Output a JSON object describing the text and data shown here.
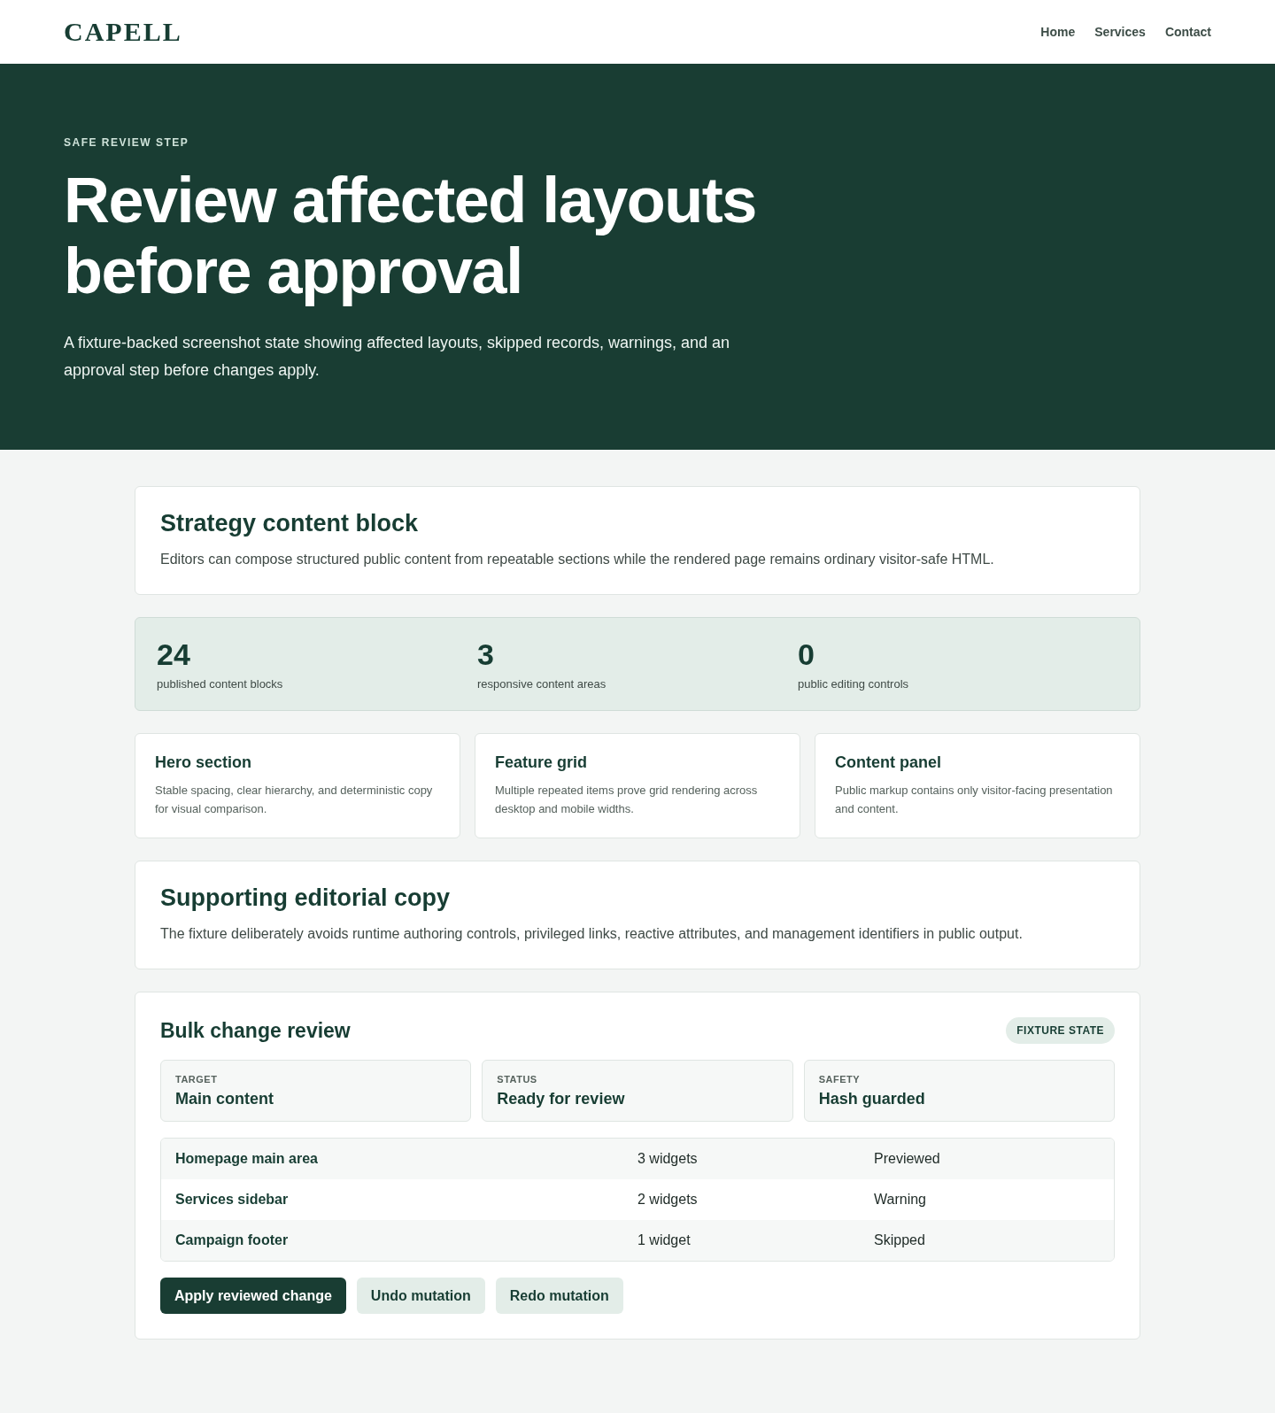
{
  "brand": "CAPELL",
  "nav": [
    {
      "label": "Home"
    },
    {
      "label": "Services"
    },
    {
      "label": "Contact"
    }
  ],
  "hero": {
    "eyebrow": "SAFE REVIEW STEP",
    "title": "Review affected layouts before approval",
    "text": "A fixture-backed screenshot state showing affected layouts, skipped records, warnings, and an approval step before changes apply."
  },
  "strategy": {
    "title": "Strategy content block",
    "text": "Editors can compose structured public content from repeatable sections while the rendered page remains ordinary visitor-safe HTML."
  },
  "stats": [
    {
      "value": "24",
      "label": "published content blocks"
    },
    {
      "value": "3",
      "label": "responsive content areas"
    },
    {
      "value": "0",
      "label": "public editing controls"
    }
  ],
  "features": [
    {
      "title": "Hero section",
      "text": "Stable spacing, clear hierarchy, and deterministic copy for visual comparison."
    },
    {
      "title": "Feature grid",
      "text": "Multiple repeated items prove grid rendering across desktop and mobile widths."
    },
    {
      "title": "Content panel",
      "text": "Public markup contains only visitor-facing presentation and content."
    }
  ],
  "supporting": {
    "title": "Supporting editorial copy",
    "text": "The fixture deliberately avoids runtime authoring controls, privileged links, reactive attributes, and management identifiers in public output."
  },
  "review": {
    "title": "Bulk change review",
    "badge": "FIXTURE STATE",
    "facts": [
      {
        "label": "TARGET",
        "value": "Main content"
      },
      {
        "label": "STATUS",
        "value": "Ready for review"
      },
      {
        "label": "SAFETY",
        "value": "Hash guarded"
      }
    ],
    "rows": [
      {
        "name": "Homepage main area",
        "count": "3 widgets",
        "status": "Previewed"
      },
      {
        "name": "Services sidebar",
        "count": "2 widgets",
        "status": "Warning"
      },
      {
        "name": "Campaign footer",
        "count": "1 widget",
        "status": "Skipped"
      }
    ],
    "buttons": [
      {
        "label": "Apply reviewed change",
        "kind": "primary"
      },
      {
        "label": "Undo mutation",
        "kind": "secondary"
      },
      {
        "label": "Redo mutation",
        "kind": "secondary"
      }
    ]
  }
}
